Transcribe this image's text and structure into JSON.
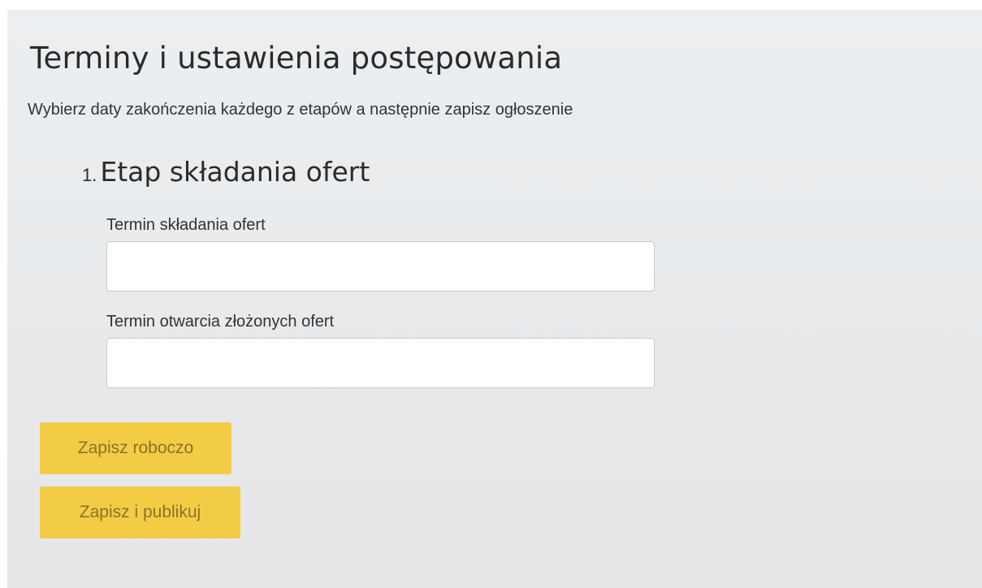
{
  "page": {
    "title": "Terminy i ustawienia postępowania",
    "subtitle": "Wybierz daty zakończenia każdego z etapów a następnie zapisz ogłoszenie"
  },
  "stage": {
    "number": "1.",
    "title": "Etap składania ofert",
    "fields": [
      {
        "label": "Termin składania ofert",
        "value": "",
        "placeholder": ""
      },
      {
        "label": "Termin otwarcia złożonych ofert",
        "value": "",
        "placeholder": ""
      }
    ]
  },
  "actions": {
    "save_draft_label": "Zapisz roboczo",
    "save_publish_label": "Zapisz i publikuj"
  },
  "colors": {
    "button_background": "#f3cc46",
    "button_text": "#8a7326",
    "panel_background": "#e9ebed"
  }
}
